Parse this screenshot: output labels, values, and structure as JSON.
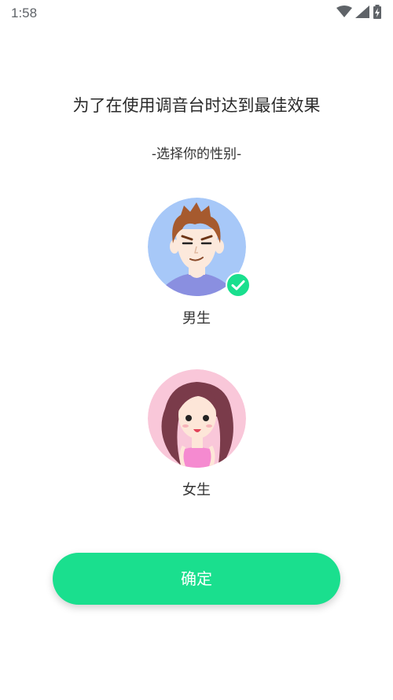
{
  "status_bar": {
    "time": "1:58"
  },
  "headline": "为了在使用调音台时达到最佳效果",
  "subhead": "-选择你的性别-",
  "options": [
    {
      "label": "男生",
      "selected": true,
      "icon": "male-avatar-icon"
    },
    {
      "label": "女生",
      "selected": false,
      "icon": "female-avatar-icon"
    }
  ],
  "confirm_label": "确定",
  "colors": {
    "accent": "#1adf8e",
    "male_bg": "#a7c8f8",
    "female_bg": "#f9c7d9"
  }
}
